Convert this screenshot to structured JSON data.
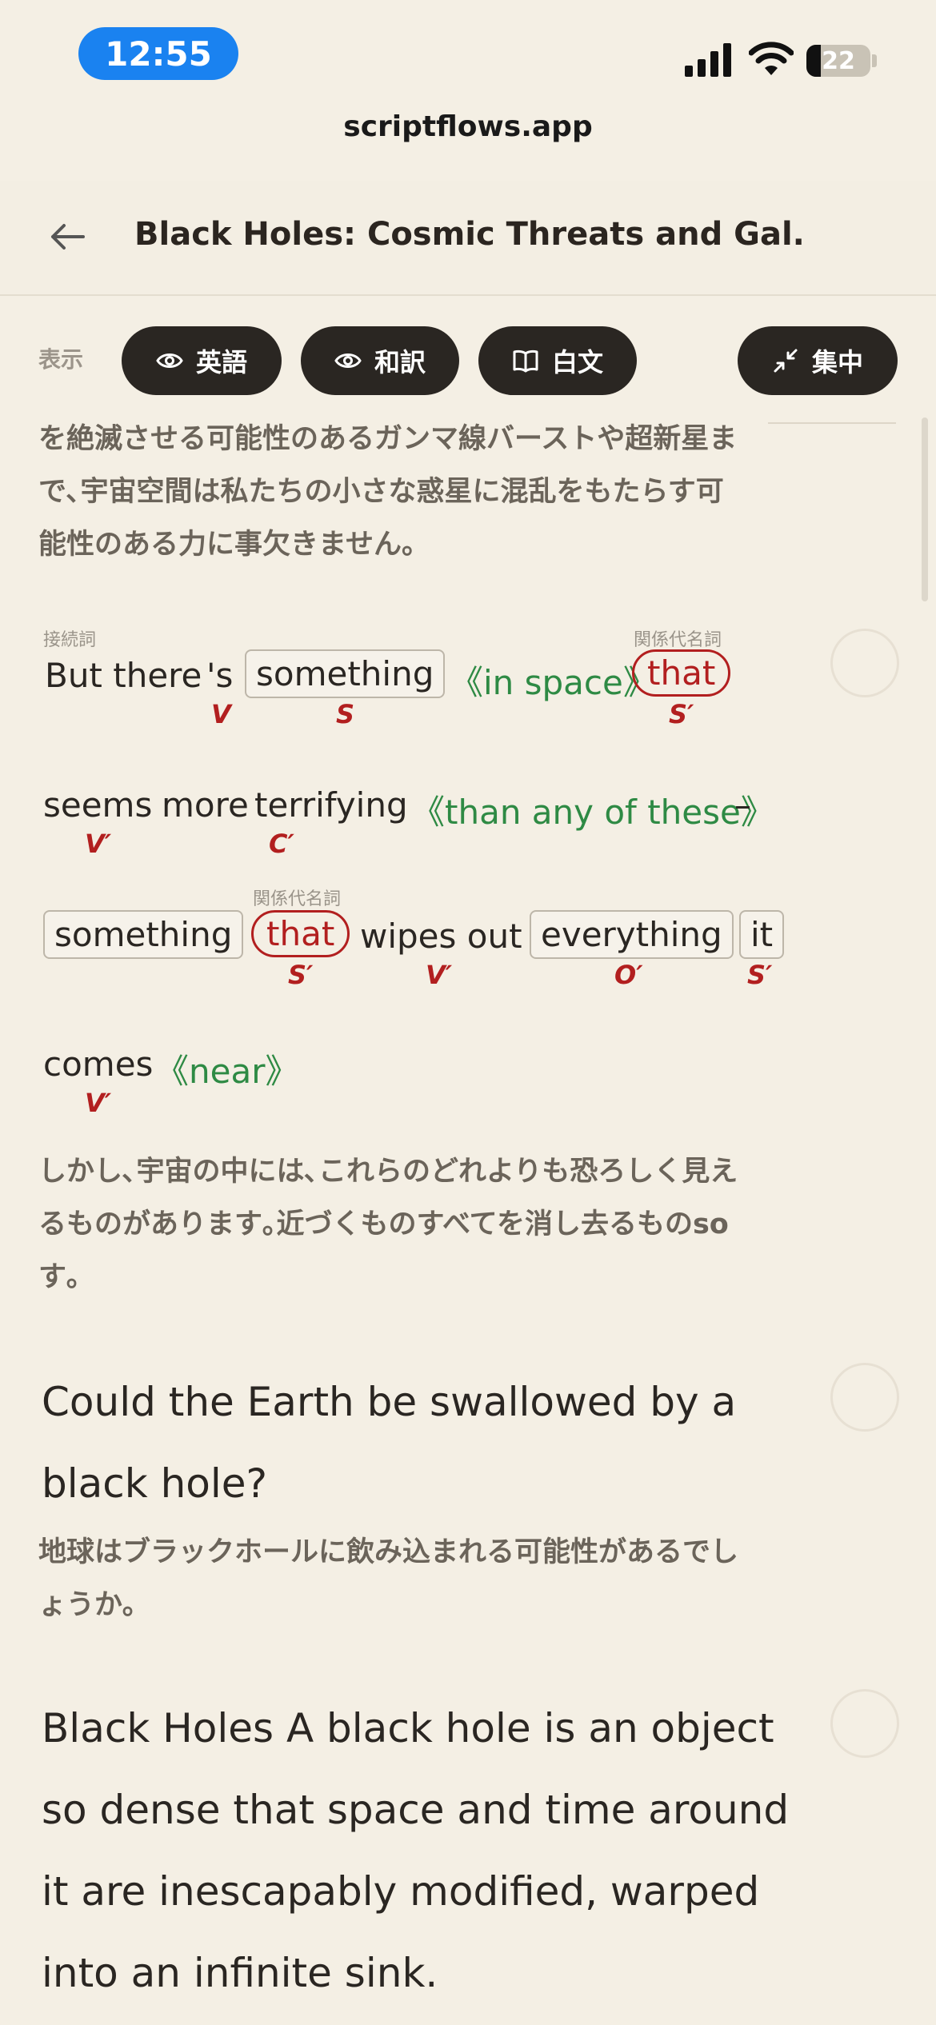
{
  "status": {
    "time": "12:55",
    "battery": "22",
    "battery_level": 0.22
  },
  "url": "scriptflows.app",
  "header": {
    "title": "Black Holes: Cosmic Threats and Gal..."
  },
  "toolbar": {
    "display_label": "表示",
    "english": "英語",
    "translation": "和訳",
    "plain": "白文",
    "focus": "集中"
  },
  "content": {
    "jp_intro_1": "を絶滅させる可能性のあるガンマ線バーストや超新星ま",
    "jp_intro_2": "で､宇宙空間は私たちの小さな惑星に混乱をもたらす可",
    "jp_intro_3": "能性のある力に事欠きません。",
    "sentence1": {
      "row1": {
        "tag_conj": "接続詞",
        "t_but": "But there",
        "t_s": "'s",
        "t_something": "something",
        "t_inspace": "《in space》",
        "tag_rel": "関係代名詞",
        "t_that": "that",
        "r_v": "V",
        "r_s": "S",
        "r_s2": "S′"
      },
      "row2": {
        "t_seems": "seems",
        "t_more": "more",
        "t_terrifying": "terrifying",
        "t_than": "《than any of these》",
        "t_dash": "–",
        "r_v": "V′",
        "r_c": "C′"
      },
      "row3": {
        "t_something": "something",
        "tag_rel": "関係代名詞",
        "t_that": "that",
        "t_wipes": "wipes out",
        "t_everything": "everything",
        "t_it": "it",
        "r_s1": "S′",
        "r_v": "V′",
        "r_o": "O′",
        "r_s2": "S′"
      },
      "row4": {
        "t_comes": "comes",
        "t_near": "《near》",
        "r_v": "V′"
      }
    },
    "jp_1_a": "しかし､宇宙の中には､これらのどれよりも恐ろしく見え",
    "jp_1_b": "るものがあります｡近づくものすべてを消し去るものso",
    "jp_1_c": "す｡",
    "q_line1": "Could the Earth be swallowed by a",
    "q_line2": "black hole?",
    "jp_q_a": "地球はブラックホールに飲み込まれる可能性があるでし",
    "jp_q_b": "ょうか｡",
    "p_line1": "Black Holes A black hole is an object",
    "p_line2": "so dense that space and time around",
    "p_line3": "it are inescapably modified, warped",
    "p_line4": "into an infinite sink."
  }
}
